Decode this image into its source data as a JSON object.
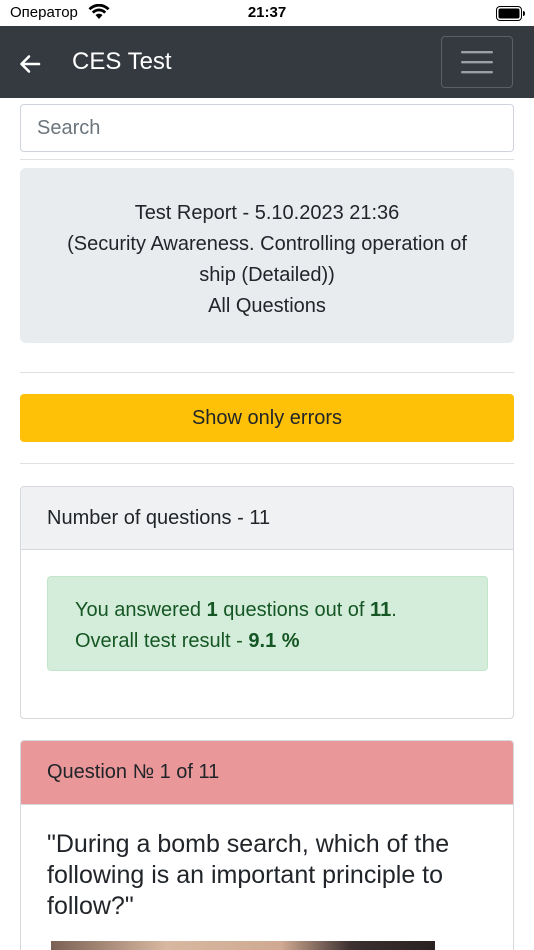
{
  "status_bar": {
    "carrier": "Оператор",
    "time": "21:37"
  },
  "navbar": {
    "title": "CES Test",
    "back_icon": "arrow-left-icon",
    "menu_icon": "hamburger-menu-icon"
  },
  "search": {
    "placeholder": "Search",
    "value": ""
  },
  "report": {
    "line1": "Test Report - 5.10.2023 21:36",
    "line2": "(Security Awareness. Controlling operation of",
    "line3": "ship (Detailed))",
    "line4": "All Questions"
  },
  "errors_button": {
    "label": "Show only errors",
    "color": "#ffc107"
  },
  "summary": {
    "header": "Number of questions - 11",
    "answered_prefix": "You answered ",
    "answered_count": "1",
    "answered_middle": " questions out of ",
    "total_count": "11",
    "answered_suffix": ".",
    "result_prefix": "Overall test result - ",
    "result_value": "9.1 %"
  },
  "question": {
    "header": "Question № 1 of 11",
    "text": "\"During a bomb search, which of the following is an important principle to follow?\"",
    "header_color": "#e99799"
  }
}
